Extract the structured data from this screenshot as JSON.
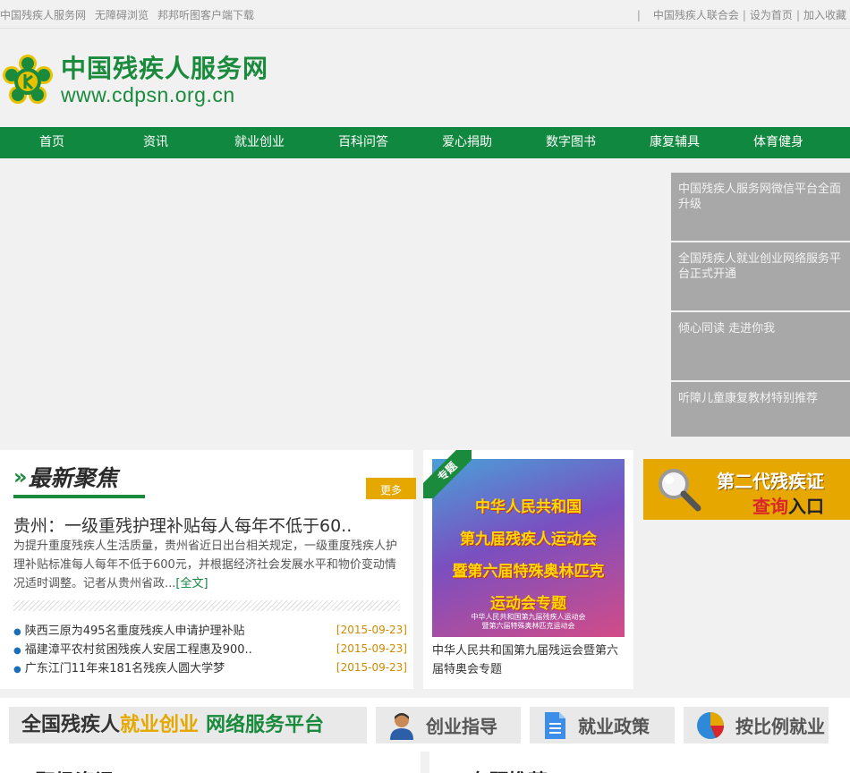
{
  "topbar": {
    "left_links": [
      "中国残疾人服务网",
      "无障碍浏览",
      "邦邦听图客户端下载"
    ],
    "right_links": [
      "中国残疾人联合会",
      "设为首页",
      "加入收藏"
    ],
    "separator": "|"
  },
  "header": {
    "logo_cn": "中国残疾人服务网",
    "logo_url": "www.cdpsn.org.cn"
  },
  "nav": {
    "items": [
      "首页",
      "资讯",
      "就业创业",
      "百科问答",
      "爱心捐助",
      "数字图书",
      "康复辅具",
      "体育健身"
    ]
  },
  "banner": {
    "side_items": [
      "中国残疾人服务网微信平台全面升级",
      "全国残疾人就业创业网络服务平台正式开通",
      "倾心同读 走进你我",
      "听障儿童康复教材特别推荐"
    ]
  },
  "news": {
    "title": "最新聚焦",
    "more": "更多",
    "headline": "贵州：一级重残护理补贴每人每年不低于60..",
    "summary": "为提升重度残疾人生活质量，贵州省近日出台相关规定，一级重度残疾人护理补贴标准每人每年不低于600元，并根据经济社会发展水平和物价变动情况适时调整。记者从贵州省政...",
    "full_link": "[全文]",
    "items": [
      {
        "title": "陕西三原为495名重度残疾人申请护理补贴",
        "date": "[2015-09-23]"
      },
      {
        "title": "福建漳平农村贫困残疾人安居工程惠及900..",
        "date": "[2015-09-23]"
      },
      {
        "title": "广东江门11年来181名残疾人圆大学梦",
        "date": "[2015-09-23]"
      }
    ]
  },
  "topic": {
    "ribbon": "专题",
    "image_lines": [
      "中华人民共和国",
      "第九届残疾人运动会",
      "暨第六届特殊奥林匹克",
      "运动会专题"
    ],
    "image_sub": [
      "中华人民共和国第九届残疾人运动会",
      "暨第六届特殊奥林匹克运动会"
    ],
    "caption": "中华人民共和国第九届残运会暨第六届特奥会专题"
  },
  "query": {
    "line1": "第二代残疾证",
    "line2_a": "查询",
    "line2_b": "入口"
  },
  "strip": {
    "platform_p1": "全国残疾人",
    "platform_p2": "就业创业",
    "platform_p3": "网络服务平台",
    "buttons": [
      "创业指导",
      "就业政策",
      "按比例就业"
    ]
  },
  "bottom": {
    "left_title": "职场资讯",
    "right_title": "专题推荐"
  },
  "colors": {
    "green": "#11883f",
    "gold": "#e6a800",
    "gray_panel": "#a8a8a8"
  }
}
